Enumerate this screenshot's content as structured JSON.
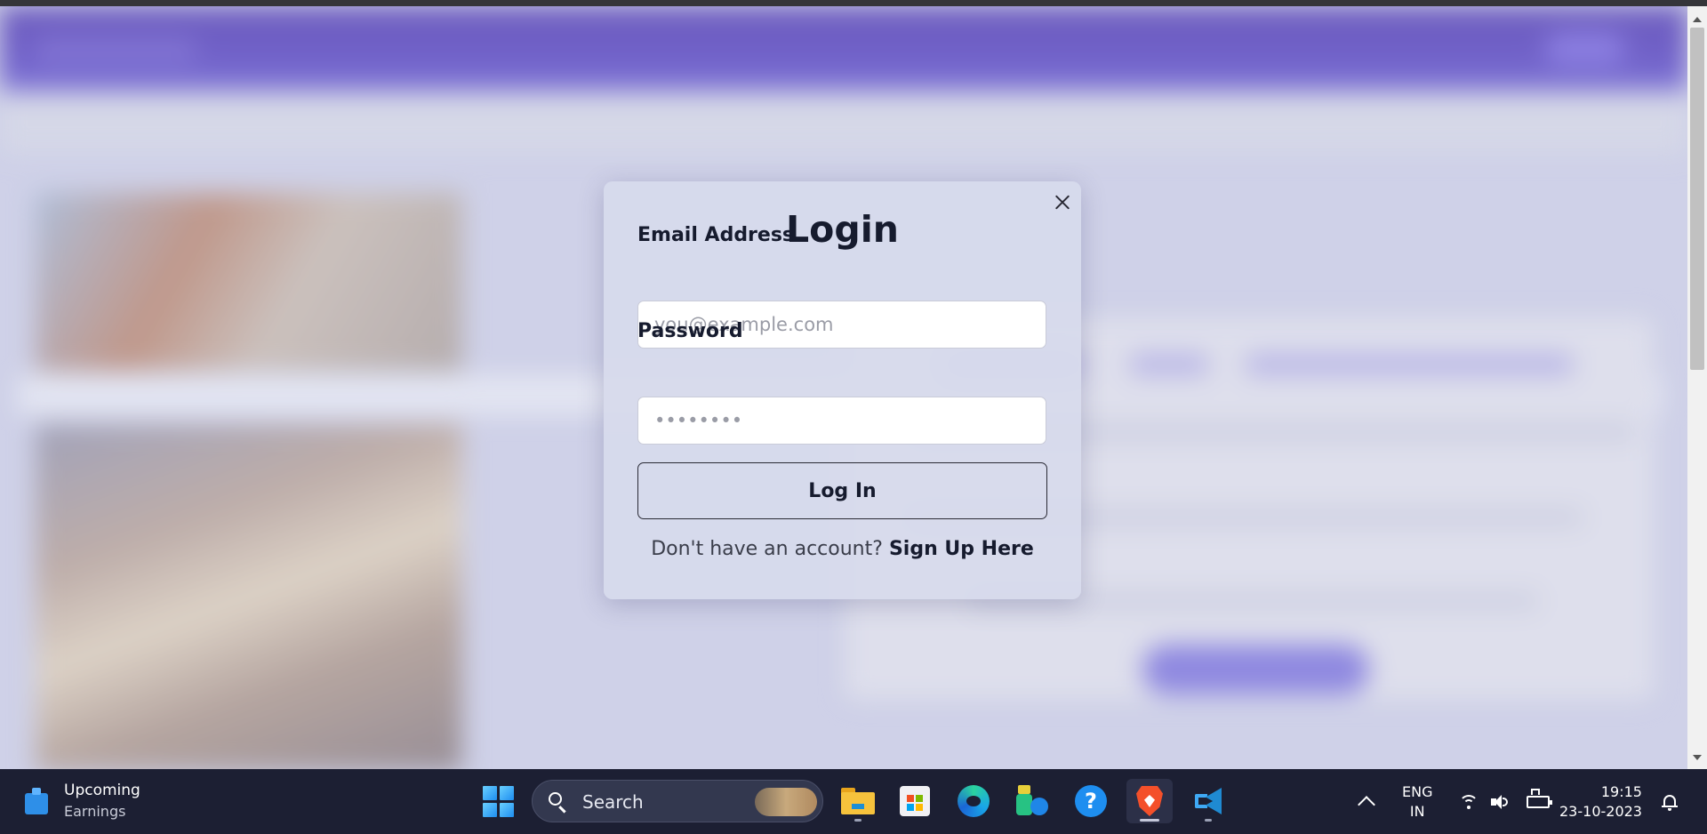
{
  "modal": {
    "title": "Login",
    "close_icon": "close-icon",
    "email_label": "Email Address",
    "email_placeholder": "you@example.com",
    "email_value": "",
    "password_label": "Password",
    "password_placeholder": "••••••••",
    "password_value": "",
    "login_button": "Log In",
    "signup_prompt": "Don't have an account?",
    "signup_link": "Sign Up Here"
  },
  "taskbar": {
    "weather": {
      "icon": "stock-chart-icon",
      "line1": "Upcoming",
      "line2": "Earnings"
    },
    "start_icon": "windows-start-icon",
    "search": {
      "placeholder": "Search",
      "icon": "search-icon"
    },
    "apps": [
      {
        "name": "file-explorer",
        "icon": "folder-icon"
      },
      {
        "name": "microsoft-store",
        "icon": "store-icon"
      },
      {
        "name": "edge",
        "icon": "edge-icon"
      },
      {
        "name": "app-green",
        "icon": "app-icon"
      },
      {
        "name": "help",
        "icon": "help-icon",
        "glyph": "?"
      },
      {
        "name": "brave",
        "icon": "brave-icon"
      },
      {
        "name": "vscode",
        "icon": "vscode-icon"
      }
    ],
    "tray": {
      "lang_line1": "ENG",
      "lang_line2": "IN",
      "time": "19:15",
      "date": "23-10-2023"
    }
  },
  "colors": {
    "nav_purple": "#3e25b8",
    "taskbar_bg": "#1c1f33",
    "modal_text": "#161b2e"
  }
}
